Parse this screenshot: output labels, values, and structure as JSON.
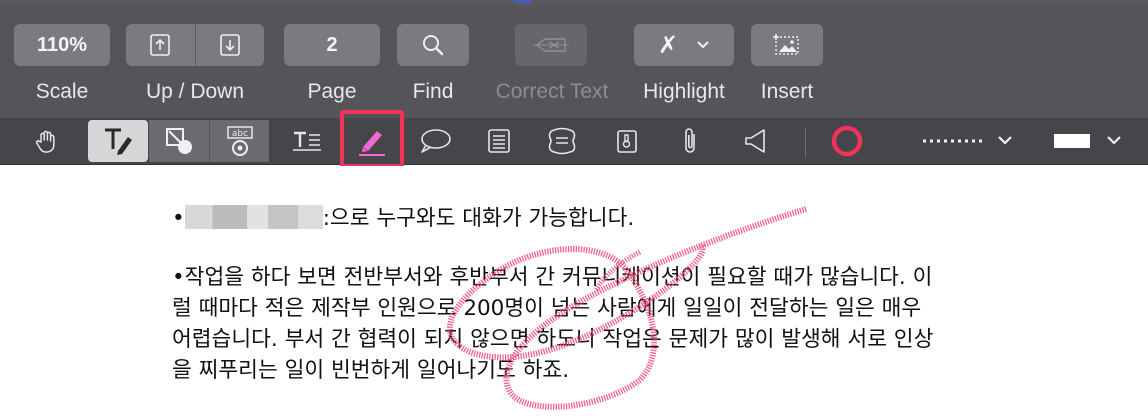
{
  "toolbar": {
    "scale": {
      "value": "110%",
      "label": "Scale"
    },
    "up_down": {
      "label": "Up / Down"
    },
    "page": {
      "value": "2",
      "label": "Page"
    },
    "find": {
      "label": "Find"
    },
    "correct_text": {
      "label": "Correct Text",
      "disabled": true
    },
    "highlight": {
      "label": "Highlight",
      "symbol": "✗"
    },
    "insert": {
      "label": "Insert"
    }
  },
  "annotation_tools": [
    {
      "name": "hand-tool",
      "icon": "hand-icon"
    },
    {
      "name": "text-tool",
      "icon": "text-cursor-icon",
      "selected": true
    },
    {
      "name": "shape-tool",
      "icon": "shape-icon"
    },
    {
      "name": "ocr-tool",
      "icon": "abc-icon",
      "icon_text": "abc"
    },
    {
      "name": "text-box-tool",
      "icon": "text-box-icon"
    },
    {
      "name": "pen-tool",
      "icon": "pen-icon",
      "active": true
    },
    {
      "name": "comment-tool",
      "icon": "speech-bubble-icon"
    },
    {
      "name": "note-tool",
      "icon": "note-icon"
    },
    {
      "name": "bubble-tool",
      "icon": "rounded-square-icon"
    },
    {
      "name": "stamp-tool",
      "icon": "stamp-icon"
    },
    {
      "name": "attach-tool",
      "icon": "paperclip-icon"
    },
    {
      "name": "audio-tool",
      "icon": "speaker-icon"
    }
  ],
  "style": {
    "stroke_color": "#f0335a",
    "line_style": "dotted",
    "fill_color": "#ffffff"
  },
  "document": {
    "para1_suffix": ":으로 누구와도 대화가 가능합니다.",
    "para2": [
      "•작업을 하다 보면 전반부서와 후반부서 간 커뮤니케이션이 필요할 때가 많습니다. 이",
      "럴 때마다 적은 제작부 인원으로 200명이 넘는 사람에게 일일이 전달하는 일은 매우",
      "어렵습니다. 부서 간 협력이 되지 않으면 하도니 작업은 문제가 많이 발생해 서로 인상",
      "을 찌푸리는 일이 빈번하게 일어나기도 하죠."
    ],
    "bullet": "•"
  },
  "colors": {
    "toolbar_bg": "#545459",
    "annobar_bg": "#45454a",
    "accent": "#f0335a",
    "pen_ink": "#f0507a"
  }
}
